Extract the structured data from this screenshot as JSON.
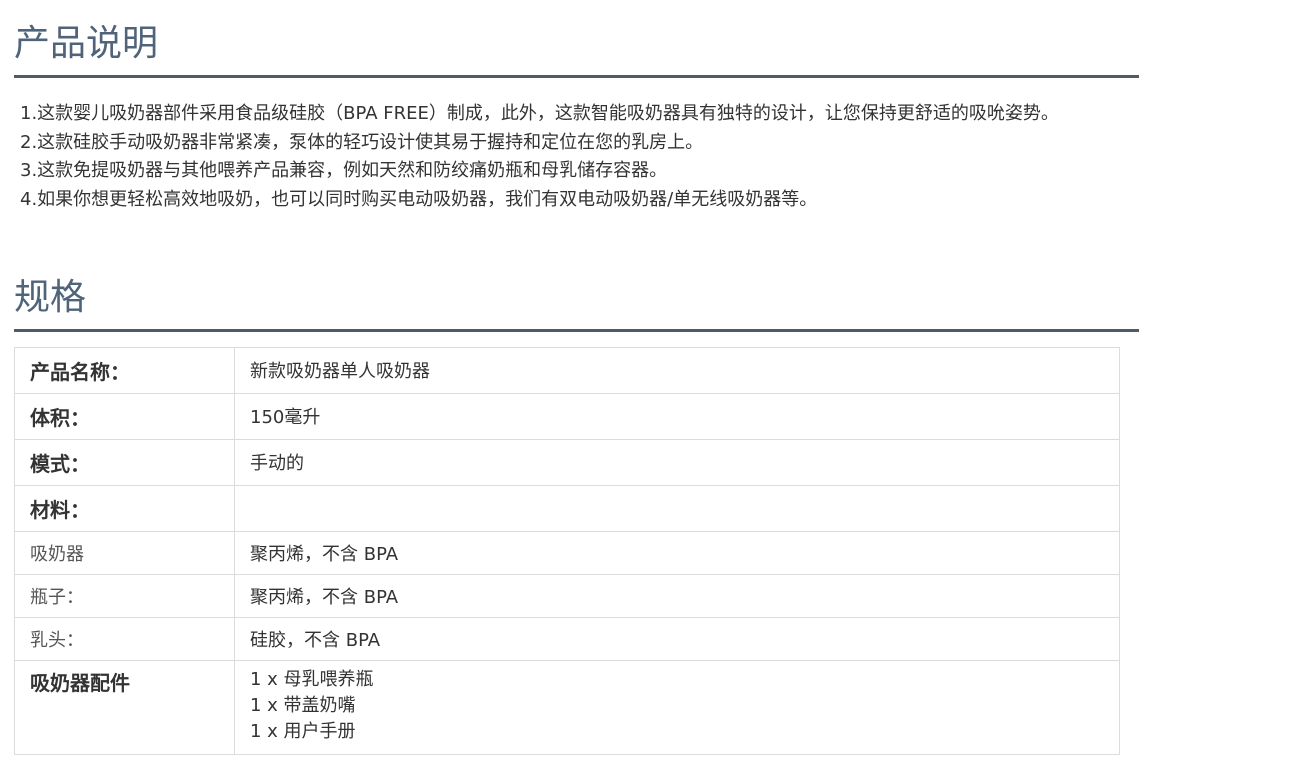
{
  "description": {
    "heading": "产品说明",
    "items": [
      "1.这款婴儿吸奶器部件采用食品级硅胶（BPA FREE）制成，此外，这款智能吸奶器具有独特的设计，让您保持更舒适的吸吮姿势。",
      "2.这款硅胶手动吸奶器非常紧凑，泵体的轻巧设计使其易于握持和定位在您的乳房上。",
      "3.这款免提吸奶器与其他喂养产品兼容，例如天然和防绞痛奶瓶和母乳储存容器。",
      "4.如果你想更轻松高效地吸奶，也可以同时购买电动吸奶器，我们有双电动吸奶器/单无线吸奶器等。"
    ]
  },
  "specs": {
    "heading": "规格",
    "rows": [
      {
        "key": "产品名称：",
        "value": "新款吸奶器单人吸奶器"
      },
      {
        "key": "体积：",
        "value": "150毫升"
      },
      {
        "key": "模式：",
        "value": "手动的"
      },
      {
        "key": "材料：",
        "value": ""
      },
      {
        "key": "吸奶器",
        "value": "聚丙烯，不含 BPA"
      },
      {
        "key": "瓶子：",
        "value": "聚丙烯，不含 BPA"
      },
      {
        "key": "乳头：",
        "value": "硅胶，不含 BPA"
      },
      {
        "key": "吸奶器配件",
        "values": [
          "1 x 母乳喂养瓶",
          "1 x 带盖奶嘴",
          "1 x 用户手册"
        ]
      }
    ]
  }
}
